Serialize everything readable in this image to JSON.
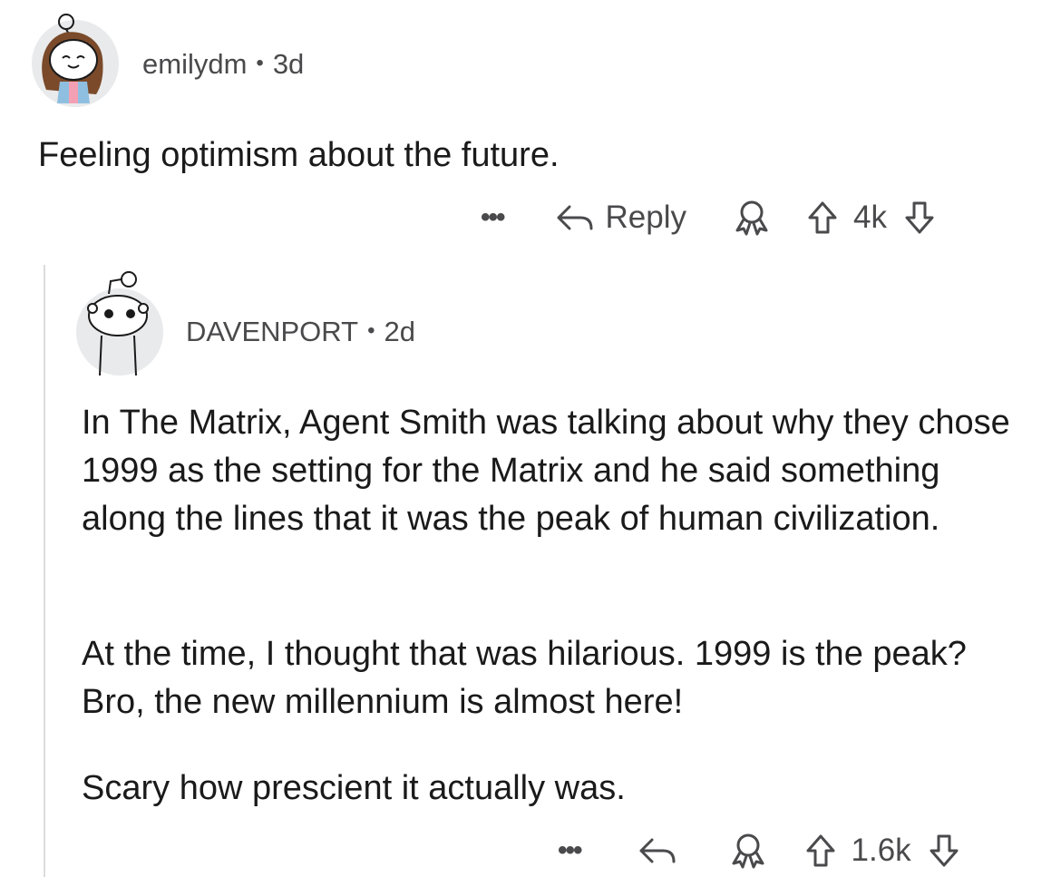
{
  "comment1": {
    "username": "emilydm",
    "separator": "•",
    "age": "3d",
    "text": "Feeling optimism about the future.",
    "actions": {
      "more": "•••",
      "reply": "Reply",
      "votes": "4k"
    }
  },
  "comment2": {
    "username": "DAVENPORT",
    "separator": "•",
    "age": "2d",
    "paragraphs": [
      "In The Matrix, Agent Smith was talking about why they chose 1999 as the setting for the Matrix and he said something along the lines that it was the peak of human civilization.",
      "At the time, I thought that was hilarious. 1999 is the peak? Bro, the new millennium is almost here!",
      "Scary how prescient it actually was."
    ],
    "actions": {
      "more": "•••",
      "votes": "1.6k"
    }
  },
  "icons": {
    "reply": "reply-arrow-icon",
    "award": "award-icon",
    "upvote": "upvote-arrow-icon",
    "downvote": "downvote-arrow-icon",
    "avatar1": "snoo-avatar-girl",
    "avatar2": "snoo-avatar-default"
  }
}
